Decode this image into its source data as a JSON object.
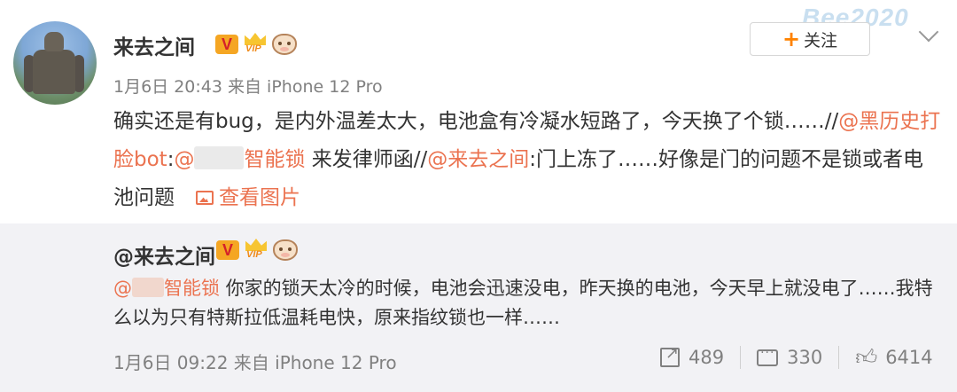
{
  "post": {
    "username": "来去之间",
    "meta": "1月6日 20:43 来自 iPhone 12 Pro",
    "follow_label": "关注",
    "watermark": "Bee2020",
    "content": {
      "part1": "确实还是有bug，是内外温差太大，电池盒有冷凝水短路了，今天换了个锁……//",
      "mention1": "@黑历史打脸bot",
      "colon1": ":",
      "mention2_prefix": "@",
      "mention2_suffix": "智能锁",
      "part2": " 来发律师函//",
      "mention3": "@来去之间",
      "part3": ":门上冻了……好像是门的问题不是锁或者电池问题",
      "view_pic": "查看图片"
    }
  },
  "repost": {
    "username": "@来去之间",
    "mention_prefix": "@",
    "mention_suffix": "智能锁",
    "content": " 你家的锁天太冷的时候，电池会迅速没电，昨天换的电池，今天早上就没电了……我特么以为只有特斯拉低温耗电快，原来指纹锁也一样……",
    "meta": "1月6日 09:22 来自 iPhone 12 Pro",
    "reposts": "489",
    "comments": "330",
    "likes": "6414"
  },
  "icons": {
    "v_badge": "verified-v-icon",
    "vip": "vip-crown-icon",
    "cow": "cow-badge-icon"
  },
  "colors": {
    "accent": "#eb7350",
    "follow_plus": "#ff8200",
    "repost_bg": "#f2f2f5"
  }
}
